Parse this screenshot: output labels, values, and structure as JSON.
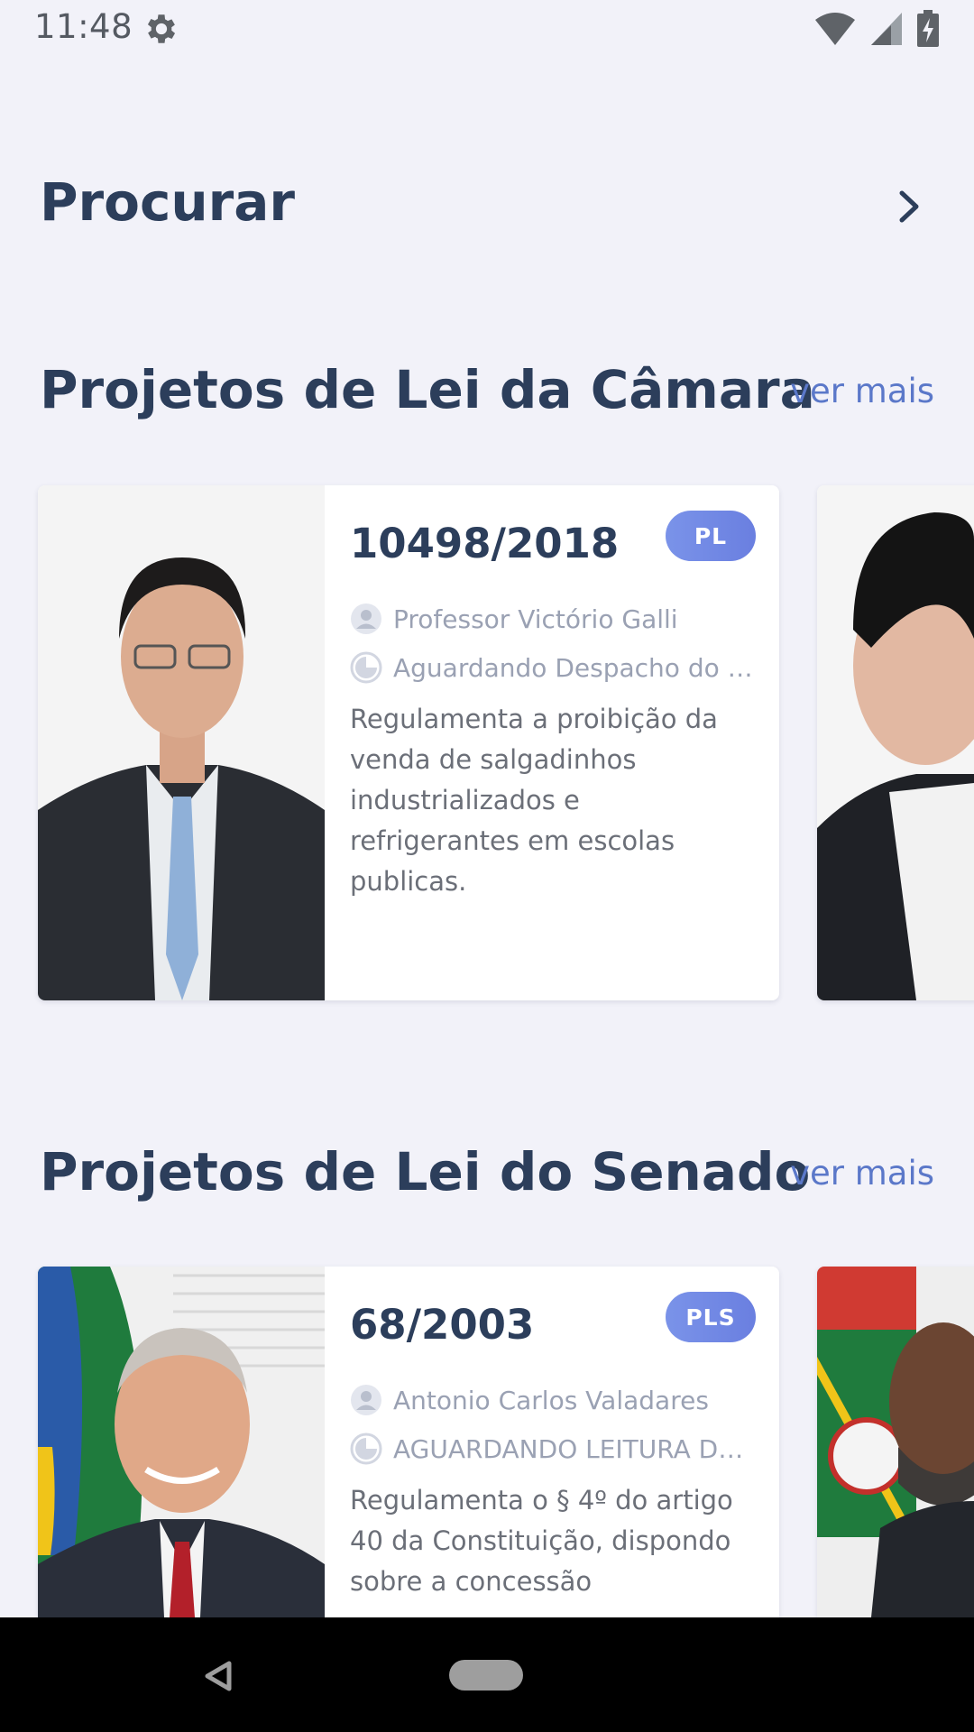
{
  "status_bar": {
    "time": "11:48",
    "icons": [
      "gear-icon",
      "wifi-icon",
      "cell-signal-icon",
      "battery-charging-icon"
    ]
  },
  "search": {
    "title": "Procurar",
    "icon": "chevron-right-icon"
  },
  "camara": {
    "title": "Projetos de Lei da Câmara",
    "see_more": "ver mais",
    "cards": [
      {
        "number": "10498/2018",
        "badge": "PL",
        "author": "Professor Victório Galli",
        "status": "Aguardando Despacho do Pr...",
        "description": "Regulamenta a proibição da venda de salgadinhos industrializados e refrigerantes em escolas publicas."
      }
    ]
  },
  "senado": {
    "title": "Projetos de Lei do Senado",
    "see_more": "ver mais",
    "cards": [
      {
        "number": "68/2003",
        "badge": "PLS",
        "author": "Antonio Carlos Valadares",
        "status": "AGUARDANDO LEITURA DE...",
        "description": "Regulamenta o § 4º do artigo 40 da Constituição, dispondo sobre a concessão"
      }
    ]
  },
  "colors": {
    "background": "#f2f2f9",
    "title": "#2c3e5b",
    "link": "#5b78c9",
    "badge": "#7389e6",
    "meta_text": "#9aa1b3"
  },
  "nav_bar": {
    "icons": [
      "back-triangle-icon",
      "home-pill-icon"
    ]
  }
}
